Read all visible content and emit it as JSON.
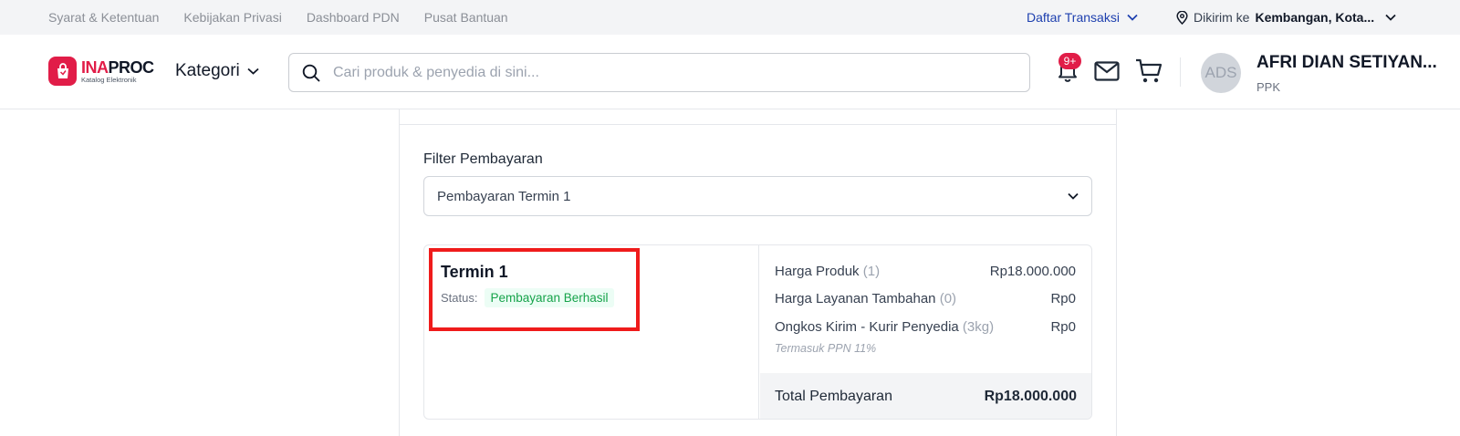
{
  "topbar": {
    "links": [
      "Syarat & Ketentuan",
      "Kebijakan Privasi",
      "Dashboard PDN",
      "Pusat Bantuan"
    ],
    "transactions_label": "Daftar Transaksi",
    "ship_prefix": "Dikirim ke",
    "ship_location": "Kembangan, Kota..."
  },
  "header": {
    "logo_word_red": "INA",
    "logo_word_dark": "PROC",
    "logo_sub": "Katalog Elektronik",
    "category_label": "Kategori",
    "search_placeholder": "Cari produk & penyedia di sini...",
    "notification_badge": "9+",
    "avatar_initials": "ADS",
    "user_name": "AFRI DIAN SETIYAN...",
    "user_role": "PPK"
  },
  "payment": {
    "filter_label": "Filter Pembayaran",
    "filter_selected": "Pembayaran Termin 1",
    "term_title": "Termin 1",
    "status_label": "Status:",
    "status_value": "Pembayaran Berhasil",
    "lines": [
      {
        "label": "Harga Produk",
        "qty": "(1)",
        "amount": "Rp18.000.000"
      },
      {
        "label": "Harga Layanan Tambahan",
        "qty": "(0)",
        "amount": "Rp0"
      },
      {
        "label": "Ongkos Kirim - Kurir Penyedia",
        "qty": "(3kg)",
        "amount": "Rp0"
      }
    ],
    "ppn_note": "Termasuk PPN 11%",
    "total_label": "Total Pembayaran",
    "total_amount": "Rp18.000.000"
  },
  "colors": {
    "brand_red": "#e11d48",
    "link_blue": "#1e40af",
    "success_green": "#16a34a",
    "highlight_red": "#ef1b1b"
  },
  "icons": [
    "location-pin-icon",
    "chevron-down-icon",
    "search-icon",
    "bell-icon",
    "mail-icon",
    "cart-icon",
    "shopping-bag-icon"
  ]
}
